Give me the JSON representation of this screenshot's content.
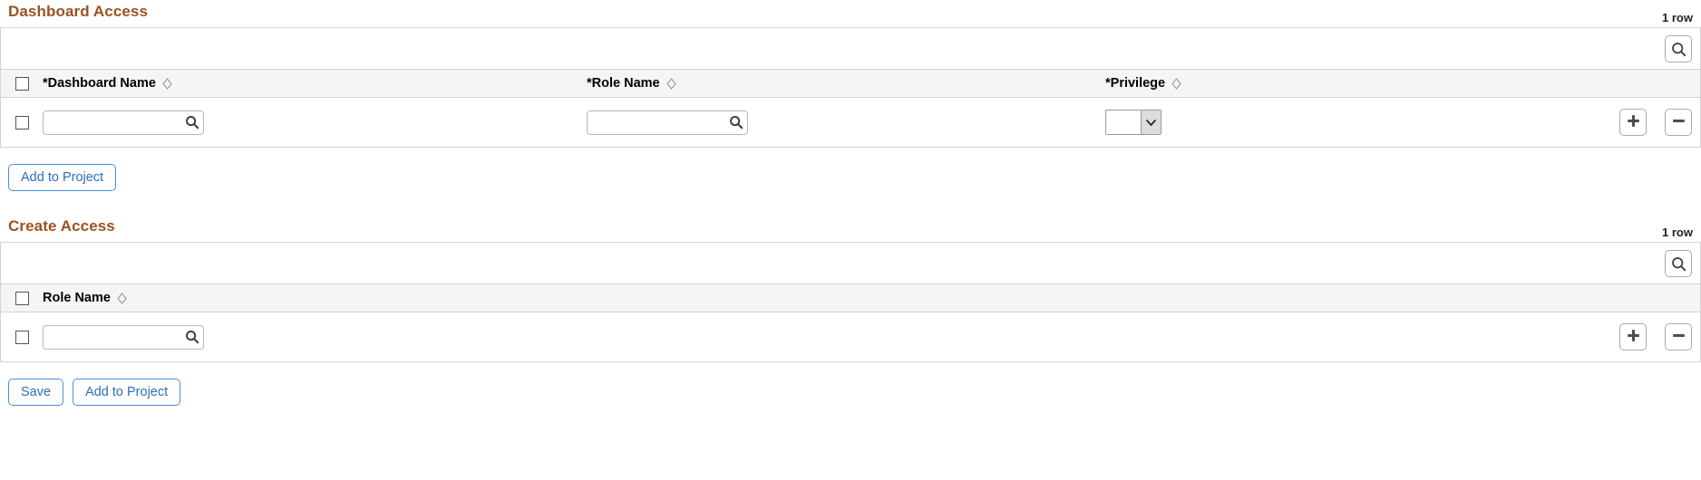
{
  "colors": {
    "section_title": "#9c5221",
    "button_text": "#2c6fbb",
    "button_border": "#4a90d9",
    "grid_border": "#d3d3d3",
    "header_band": "#f5f5f5"
  },
  "sections": [
    {
      "title": "Dashboard Access",
      "row_count": "1 row",
      "toolbar": {
        "search_icon": "search-icon",
        "search_title": "Find"
      },
      "select_all_checkbox": {
        "checked": false
      },
      "columns": [
        {
          "label": "*Dashboard Name",
          "sort_icon": "sort-diamond-icon"
        },
        {
          "label": "*Role Name",
          "sort_icon": "sort-diamond-icon"
        },
        {
          "label": "*Privilege",
          "sort_icon": "sort-diamond-icon"
        }
      ],
      "rows": [
        {
          "selected": false,
          "dashboard_name": {
            "value": "",
            "placeholder": "",
            "lookup_icon": "lookup-magnifier-icon"
          },
          "role_name": {
            "value": "",
            "placeholder": "",
            "lookup_icon": "lookup-magnifier-icon"
          },
          "privilege": {
            "value": "",
            "options": [
              ""
            ],
            "arrow_icon": "chevron-down-icon"
          },
          "add_icon": "plus-icon",
          "delete_icon": "minus-icon"
        }
      ],
      "buttons": [
        {
          "label": "Add to Project",
          "name": "add-to-project-button"
        }
      ]
    },
    {
      "title": "Create Access",
      "row_count": "1 row",
      "toolbar": {
        "search_icon": "search-icon",
        "search_title": "Find"
      },
      "select_all_checkbox": {
        "checked": false
      },
      "columns": [
        {
          "label": "Role Name",
          "sort_icon": "sort-diamond-icon"
        }
      ],
      "rows": [
        {
          "selected": false,
          "role_name": {
            "value": "",
            "placeholder": "",
            "lookup_icon": "lookup-magnifier-icon"
          },
          "add_icon": "plus-icon",
          "delete_icon": "minus-icon"
        }
      ],
      "buttons": [
        {
          "label": "Save",
          "name": "save-button"
        },
        {
          "label": "Add to Project",
          "name": "add-to-project-button-2"
        }
      ]
    }
  ]
}
